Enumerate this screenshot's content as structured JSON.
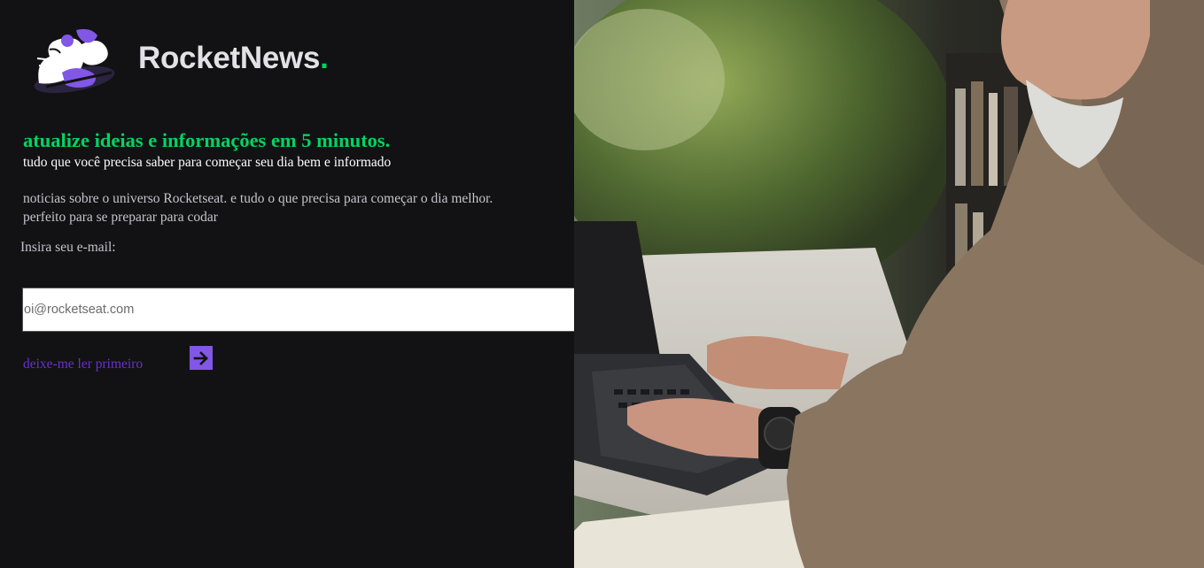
{
  "brand": {
    "name": "RocketNews",
    "dot": "."
  },
  "hero": {
    "headline": "atualize ideias e informações em 5 minutos.",
    "subheadline": "tudo que você precisa saber para começar seu dia bem e informado",
    "description_line1": "noticias sobre o universo Rocketseat. e tudo o que precisa para começar o dia melhor.",
    "description_line2": "perfeito para se preparar para codar"
  },
  "form": {
    "email_label": "Insira seu e-mail:",
    "email_placeholder": "oi@rocketseat.com",
    "email_value": "",
    "send_icon": "paper-plane-icon"
  },
  "cta": {
    "read_first_label": "deixe-me ler primeiro",
    "arrow_icon": "arrow-right-icon"
  },
  "photo": {
    "subject": "man-typing-on-laptop"
  },
  "colors": {
    "background": "#121214",
    "accent_green": "#04D361",
    "accent_purple": "#8257E5",
    "link_purple": "#6A2FD0",
    "text": "#C4C4CC"
  }
}
